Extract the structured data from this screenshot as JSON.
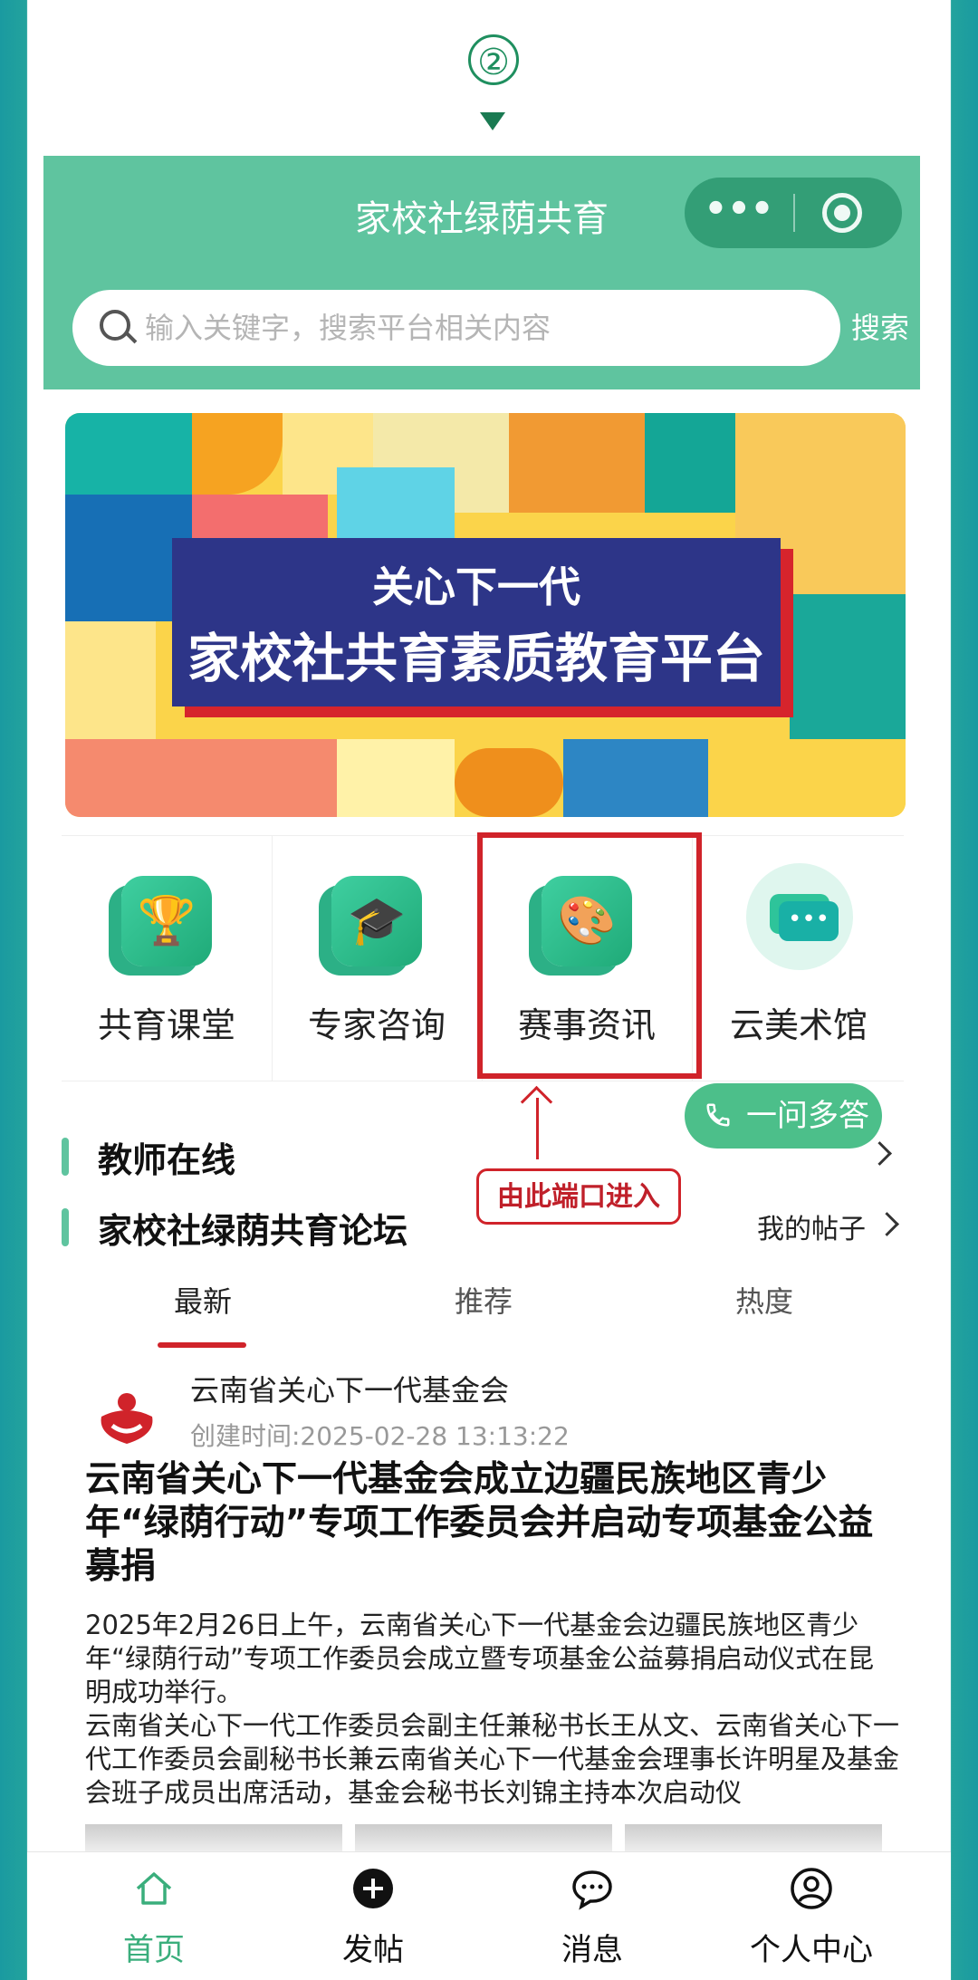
{
  "step_marker": "②",
  "header": {
    "title": "家校社绿荫共育",
    "capsule_more": "•••",
    "search": {
      "placeholder": "输入关键字，搜索平台相关内容",
      "button": "搜索"
    }
  },
  "banner": {
    "line1": "关心下一代",
    "line2": "家校社共育素质教育平台"
  },
  "menu": {
    "items": [
      {
        "label": "共育课堂",
        "icon": "trophy-icon"
      },
      {
        "label": "专家咨询",
        "icon": "graduation-cap-icon"
      },
      {
        "label": "赛事资讯",
        "icon": "palette-icon"
      },
      {
        "label": "云美术馆",
        "icon": "chat-bubble-icon"
      }
    ]
  },
  "float_button": {
    "label": "一问多答",
    "icon": "phone-icon"
  },
  "annotation": {
    "label": "由此端口进入",
    "color": "#d0232a"
  },
  "sections": {
    "teachers": "教师在线",
    "forum": "家校社绿荫共育论坛",
    "my_posts": "我的帖子"
  },
  "tabs": [
    "最新",
    "推荐",
    "热度"
  ],
  "post": {
    "author": "云南省关心下一代基金会",
    "created": "创建时间:2025-02-28 13:13:22",
    "title": "云南省关心下一代基金会成立边疆民族地区青少年“绿荫行动”专项工作委员会并启动专项基金公益募捐",
    "body1": "2025年2月26日上午，云南省关心下一代基金会边疆民族地区青少年“绿荫行动”专项工作委员会成立暨专项基金公益募捐启动仪式在昆明成功举行。",
    "body2": "云南省关心下一代工作委员会副主任兼秘书长王从文、云南省关心下一代工作委员会副秘书长兼云南省关心下一代基金会理事长许明星及基金会班子成员出席活动，基金会秘书长刘锦主持本次启动仪"
  },
  "bottom_nav": [
    {
      "label": "首页",
      "icon": "home-icon",
      "active": true
    },
    {
      "label": "发帖",
      "icon": "plus-circle-icon",
      "active": false
    },
    {
      "label": "消息",
      "icon": "message-icon",
      "active": false
    },
    {
      "label": "个人中心",
      "icon": "user-icon",
      "active": false
    }
  ],
  "colors": {
    "brand_green": "#5fc49f",
    "accent_red": "#d0232a",
    "active_nav": "#3aae7c"
  }
}
